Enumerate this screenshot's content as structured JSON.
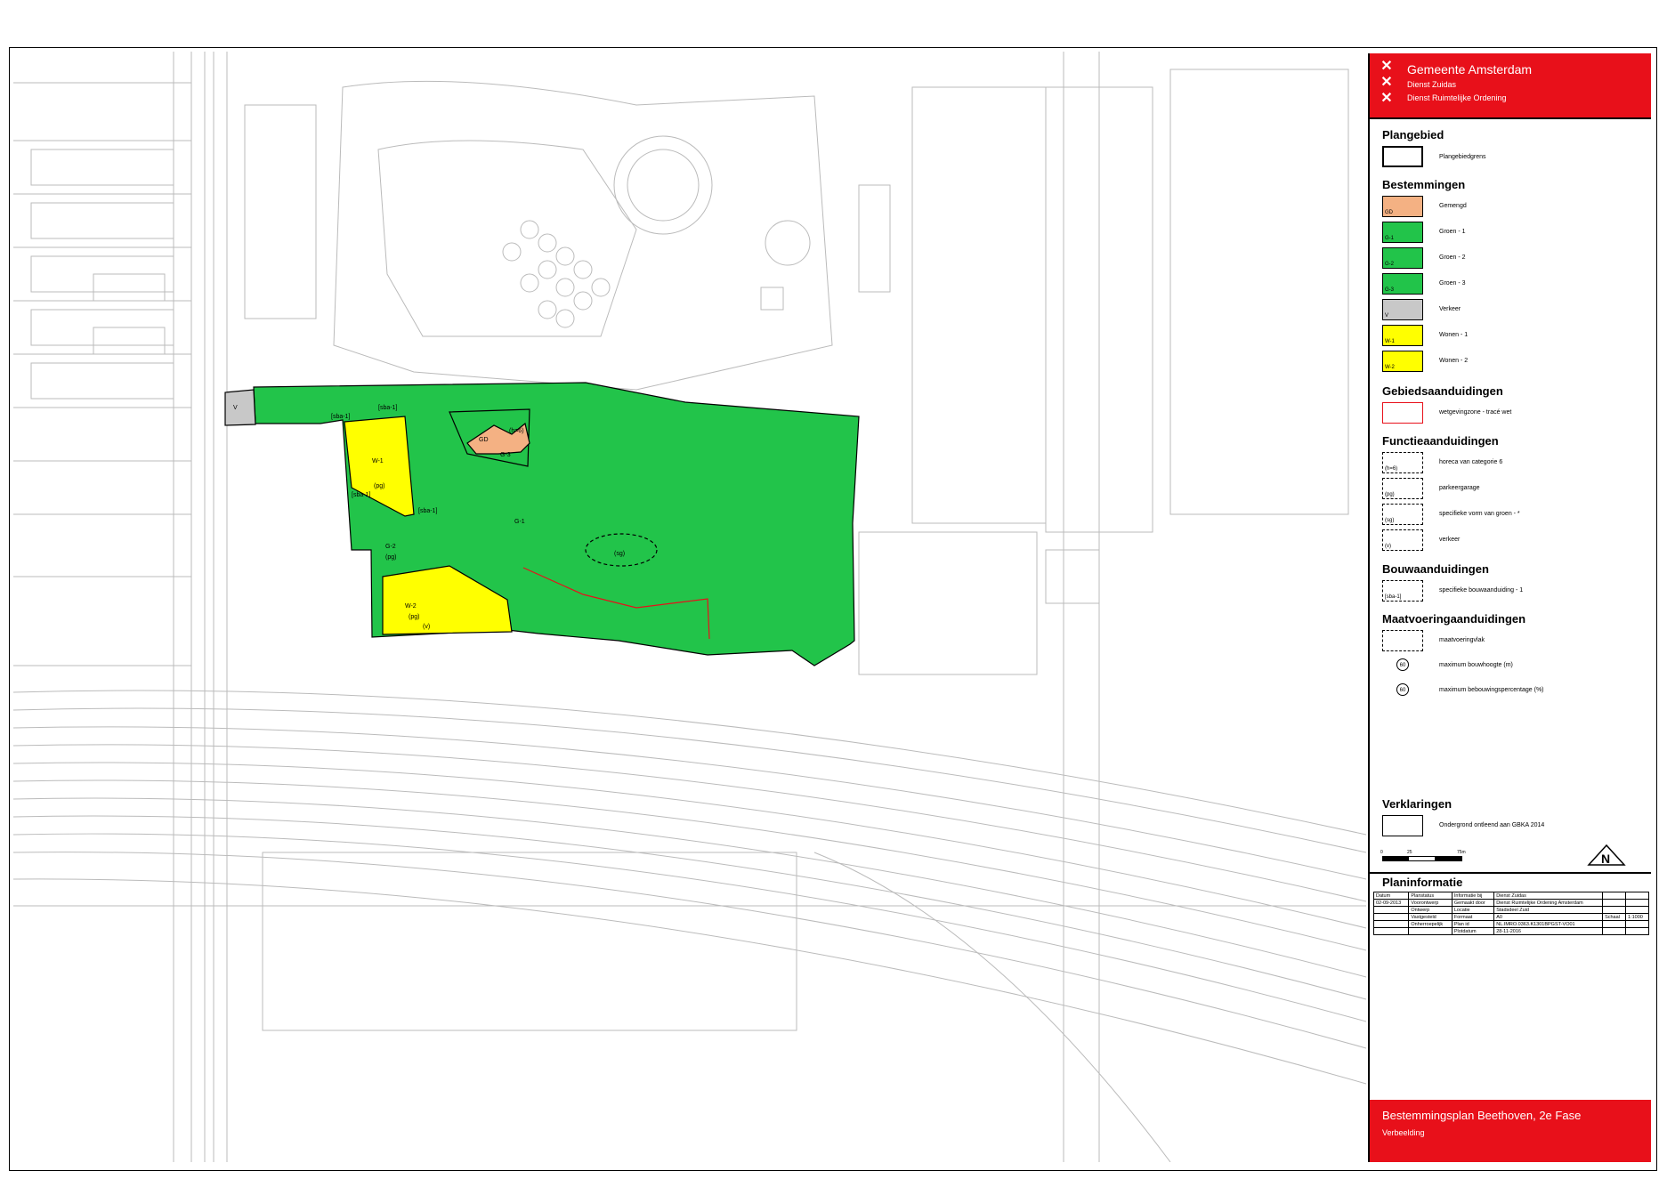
{
  "header": {
    "org_name": "Gemeente Amsterdam",
    "dept1": "Dienst Zuidas",
    "dept2": "Dienst Ruimtelijke Ordening"
  },
  "legend": {
    "plangebied": {
      "title": "Plangebied",
      "items": [
        {
          "label": "Plangebiedgrens"
        }
      ]
    },
    "bestemmingen": {
      "title": "Bestemmingen",
      "items": [
        {
          "code": "GD",
          "label": "Gemengd",
          "color": "#f4b183"
        },
        {
          "code": "G-1",
          "label": "Groen - 1",
          "color": "#22c44a"
        },
        {
          "code": "G-2",
          "label": "Groen - 2",
          "color": "#22c44a"
        },
        {
          "code": "G-3",
          "label": "Groen - 3",
          "color": "#22c44a"
        },
        {
          "code": "V",
          "label": "Verkeer",
          "color": "#c8c8c8"
        },
        {
          "code": "W-1",
          "label": "Wonen - 1",
          "color": "#ffff00"
        },
        {
          "code": "W-2",
          "label": "Wonen - 2",
          "color": "#ffff00"
        }
      ]
    },
    "gebiedsaanduidingen": {
      "title": "Gebiedsaanduidingen",
      "items": [
        {
          "label": "wetgevingzone - tracé wet",
          "color": "#e8101a"
        }
      ]
    },
    "functieaanduidingen": {
      "title": "Functieaanduidingen",
      "items": [
        {
          "code": "(h=6)",
          "label": "horeca van categorie 6"
        },
        {
          "code": "(pg)",
          "label": "parkeergarage"
        },
        {
          "code": "(sg)",
          "label": "specifieke vorm van groen - *"
        },
        {
          "code": "(v)",
          "label": "verkeer"
        }
      ]
    },
    "bouwaanduidingen": {
      "title": "Bouwaanduidingen",
      "items": [
        {
          "code": "[sba-1]",
          "label": "specifieke bouwaanduiding - 1"
        }
      ]
    },
    "maatvoering": {
      "title": "Maatvoeringaanduidingen",
      "items": [
        {
          "label": "maatvoeringvlak"
        },
        {
          "code": "60",
          "label": "maximum bouwhoogte (m)"
        },
        {
          "code": "60",
          "label": "maximum bebouwingspercentage (%)"
        }
      ]
    },
    "verklaringen": {
      "title": "Verklaringen",
      "items": [
        {
          "label": "Ondergrond ontleend aan GBKA 2014"
        }
      ]
    },
    "scale": {
      "ticks": [
        "0",
        "25",
        "75m"
      ]
    },
    "north": "N"
  },
  "planinformatie": {
    "title": "Planinformatie",
    "rows": [
      [
        "Datum",
        "Planstatus",
        "Informatie bij",
        "Dienst Zuidas",
        "",
        ""
      ],
      [
        "02-09-2013",
        "Voorontwerp",
        "Gemaakt door",
        "Dienst Ruimtelijke Ordening Amsterdam",
        "",
        ""
      ],
      [
        "",
        "Ontwerp",
        "Locatie",
        "Stadsdeel Zuid",
        "",
        ""
      ],
      [
        "",
        "Vastgesteld",
        "Formaat",
        "A0",
        "Schaal",
        "1:1000"
      ],
      [
        "",
        "Onherroepelijk",
        "Plan id",
        "NL.IMRO.0363.K1301BPGST-VO01",
        "",
        ""
      ],
      [
        "",
        "",
        "Plotdatum",
        "28-11-2016",
        "",
        ""
      ]
    ]
  },
  "footer": {
    "title": "Bestemmingsplan Beethoven, 2e Fase",
    "subtitle": "Verbeelding"
  },
  "map": {
    "zone_labels": {
      "v": "V",
      "w1": "W-1",
      "w1_pg": "(pg)",
      "gd": "GD",
      "h6": "(h=6)",
      "g3": "G-3",
      "g1": "G-1",
      "g2": "G-2",
      "g2_pg": "(pg)",
      "sg": "(sg)",
      "w2": "W-2",
      "w2_pg": "(pg)",
      "v2": "(v)",
      "sba1a": "[sba-1]",
      "sba1b": "[sba-1]",
      "sba1c": "[sba-1]",
      "sba1d": "[sba-1]"
    }
  }
}
